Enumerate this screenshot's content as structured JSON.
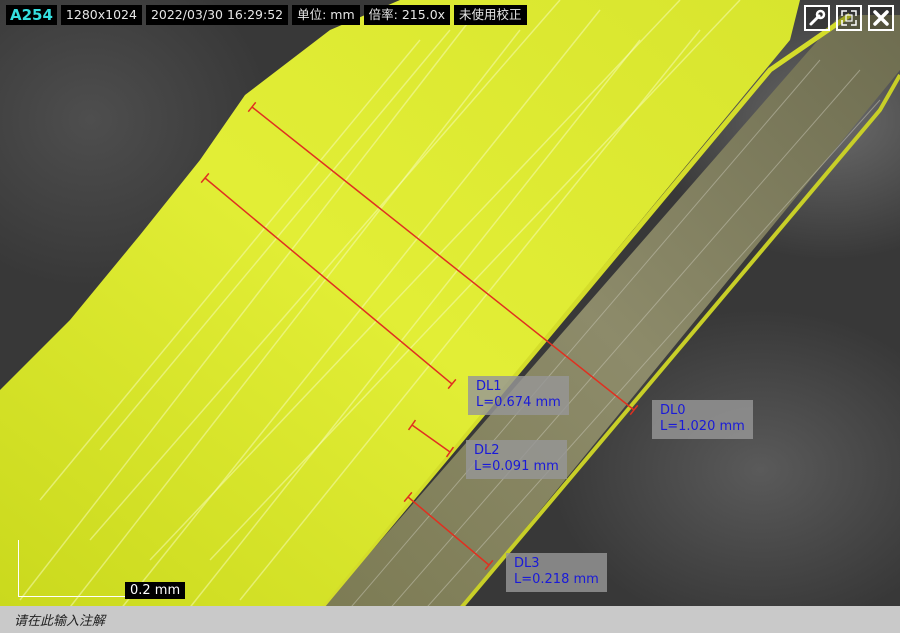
{
  "topbar": {
    "id": "A254",
    "resolution": "1280x1024",
    "datetime": "2022/03/30 16:29:52",
    "unit": "单位: mm",
    "magnification": "倍率: 215.0x",
    "calibration": "未使用校正"
  },
  "window_buttons": {
    "settings_icon": "wrench-icon",
    "fit_icon": "expand-icon",
    "close_icon": "close-icon"
  },
  "measurements": [
    {
      "name": "DL0",
      "length": "L=1.020 mm"
    },
    {
      "name": "DL1",
      "length": "L=0.674 mm"
    },
    {
      "name": "DL2",
      "length": "L=0.091 mm"
    },
    {
      "name": "DL3",
      "length": "L=0.218 mm"
    }
  ],
  "scale_bar": {
    "label": "0.2 mm"
  },
  "annotation_bar": {
    "placeholder": "请在此输入注解"
  },
  "colors": {
    "measure_line": "#e03020",
    "label_text": "#1a1ad8",
    "fiber": "#d9e62a",
    "id_text": "#35e0e0"
  }
}
